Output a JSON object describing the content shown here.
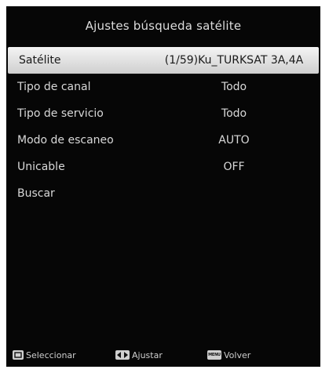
{
  "header": {
    "title": "Ajustes búsqueda satélite"
  },
  "menu": [
    {
      "label": "Satélite",
      "value": "(1/59)Ku_TURKSAT 3A,4A",
      "selected": true
    },
    {
      "label": "Tipo de canal",
      "value": "Todo"
    },
    {
      "label": "Tipo de servicio",
      "value": "Todo"
    },
    {
      "label": "Modo de escaneo",
      "value": "AUTO"
    },
    {
      "label": "Unicable",
      "value": "OFF"
    },
    {
      "label": "Buscar",
      "value": ""
    }
  ],
  "footer": {
    "select_label": "Seleccionar",
    "adjust_label": "Ajustar",
    "back_label": "Volver",
    "menu_key_text": "MENU"
  },
  "colors": {
    "background": "#060606",
    "selected_row": "#e8e8e8",
    "text": "#d8d8d8"
  },
  "icons": {
    "select": "ok-key-icon",
    "adjust": "left-right-arrows-icon",
    "back": "menu-key-icon"
  }
}
